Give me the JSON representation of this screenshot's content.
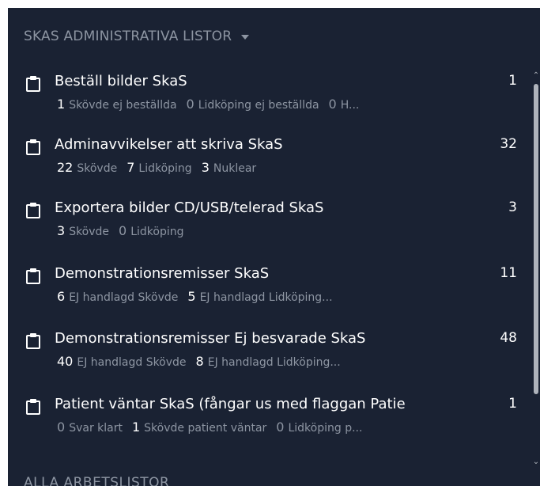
{
  "section_title": "SKAS ADMINISTRATIVA LISTOR",
  "next_section_title": "ALLA ARBETSLISTOR",
  "items": [
    {
      "title": "Beställ bilder SkaS",
      "count": "1",
      "sub": [
        {
          "num": "1",
          "label": "Skövde ej beställda"
        },
        {
          "num": "0",
          "label": "Lidköping ej beställda"
        },
        {
          "num": "0",
          "label": "H..."
        }
      ]
    },
    {
      "title": "Adminavvikelser att skriva SkaS",
      "count": "32",
      "sub": [
        {
          "num": "22",
          "label": "Skövde"
        },
        {
          "num": "7",
          "label": "Lidköping"
        },
        {
          "num": "3",
          "label": "Nuklear"
        }
      ]
    },
    {
      "title": "Exportera bilder CD/USB/telerad SkaS",
      "count": "3",
      "sub": [
        {
          "num": "3",
          "label": "Skövde"
        },
        {
          "num": "0",
          "label": "Lidköping"
        }
      ]
    },
    {
      "title": "Demonstrationsremisser SkaS",
      "count": "11",
      "sub": [
        {
          "num": "6",
          "label": "EJ handlagd Skövde"
        },
        {
          "num": "5",
          "label": "EJ handlagd Lidköping..."
        }
      ]
    },
    {
      "title": "Demonstrationsremisser Ej besvarade SkaS",
      "count": "48",
      "sub": [
        {
          "num": "40",
          "label": "EJ handlagd Skövde"
        },
        {
          "num": "8",
          "label": "EJ handlagd Lidköping..."
        }
      ]
    },
    {
      "title": "Patient väntar SkaS (fångar us med flaggan Patie",
      "count": "1",
      "sub": [
        {
          "num": "0",
          "label": "Svar klart"
        },
        {
          "num": "1",
          "label": "Skövde patient väntar"
        },
        {
          "num": "0",
          "label": "Lidköping p..."
        }
      ]
    }
  ],
  "icons": {
    "item": "clipboard-icon",
    "header": "caret-down-icon"
  },
  "colors": {
    "panel_bg": "#1a2233",
    "text": "#ffffff",
    "muted": "#8d95a2"
  }
}
